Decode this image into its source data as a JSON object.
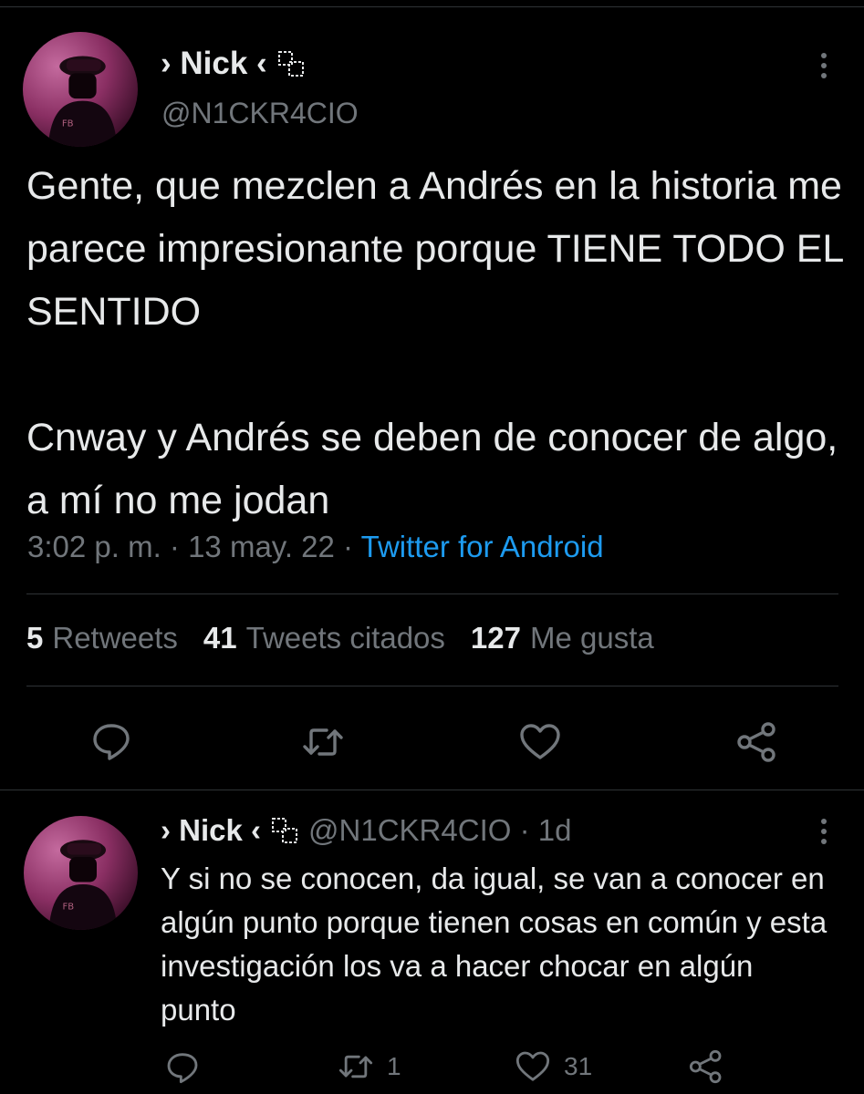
{
  "tweet": {
    "author_name": "› Nick ‹",
    "author_handle": "@N1CKR4CIO",
    "text": "Gente, que mezclen a Andrés en la historia me parece impresionante porque TIENE TODO EL SENTIDO\n\nCnway y Andrés se deben de conocer de algo, a mí no me jodan",
    "time": "3:02 p. m.",
    "separator": " · ",
    "date": "13 may. 22",
    "source": "Twitter for Android"
  },
  "stats": {
    "retweets_count": "5",
    "retweets_label": "Retweets",
    "quotes_count": "41",
    "quotes_label": "Tweets citados",
    "likes_count": "127",
    "likes_label": "Me gusta"
  },
  "reply": {
    "author_name": "› Nick ‹",
    "meta": "@N1CKR4CIO · 1d",
    "text": "Y si no se conocen, da igual, se van a conocer en algún punto porque tienen cosas en común y esta investigación los va a hacer chocar en algún punto",
    "retweet_count": "1",
    "like_count": "31"
  },
  "icons": {
    "reply": "comment-icon",
    "retweet": "retweet-icon",
    "like": "heart-icon",
    "share": "share-icon",
    "more": "more-vertical-icon",
    "badge": "dashed-squares-icon"
  },
  "colors": {
    "background": "#000000",
    "text": "#e7e9ea",
    "secondary": "#71767b",
    "link": "#1d9bf0",
    "divider": "#2f3336"
  }
}
